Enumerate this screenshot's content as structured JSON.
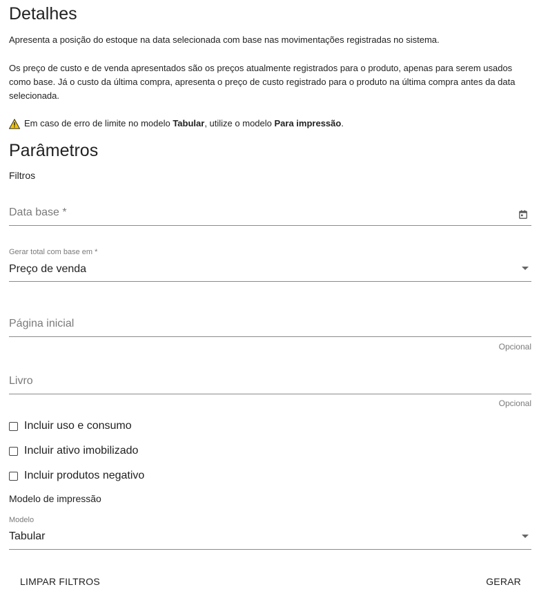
{
  "details": {
    "title": "Detalhes",
    "paragraph1": "Apresenta a posição do estoque na data selecionada com base nas movimentações registradas no sistema.",
    "paragraph2": "Os preço de custo e de venda apresentados são os preços atualmente registrados para o produto, apenas para serem usados como base. Já o custo da última compra, apresenta o preço de custo registrado para o produto na última compra antes da data selecionada.",
    "warning": {
      "icon": "warning-icon",
      "prefix": "Em caso de erro de limite no modelo ",
      "bold1": "Tabular",
      "middle": ", utilize o modelo ",
      "bold2": "Para impressão",
      "suffix": "."
    }
  },
  "params": {
    "title": "Parâmetros",
    "filters_label": "Filtros",
    "data_base": {
      "placeholder": "Data base *",
      "icon": "calendar-icon"
    },
    "gerar_total": {
      "label": "Gerar total com base em *",
      "value": "Preço de venda",
      "icon": "dropdown-arrow-icon"
    },
    "pagina_inicial": {
      "placeholder": "Página inicial",
      "hint": "Opcional"
    },
    "livro": {
      "placeholder": "Livro",
      "hint": "Opcional"
    },
    "checkboxes": [
      {
        "label": "Incluir uso e consumo",
        "checked": false
      },
      {
        "label": "Incluir ativo imobilizado",
        "checked": false
      },
      {
        "label": "Incluir produtos negativo",
        "checked": false
      }
    ],
    "print_model_label": "Modelo de impressão",
    "modelo": {
      "label": "Modelo",
      "value": "Tabular",
      "icon": "dropdown-arrow-icon"
    }
  },
  "actions": {
    "clear": "LIMPAR FILTROS",
    "generate": "GERAR"
  },
  "colors": {
    "warning": "#f5c400",
    "text": "#1f1f1f",
    "muted": "#7a7a7a",
    "underline": "#8a8a8a"
  }
}
